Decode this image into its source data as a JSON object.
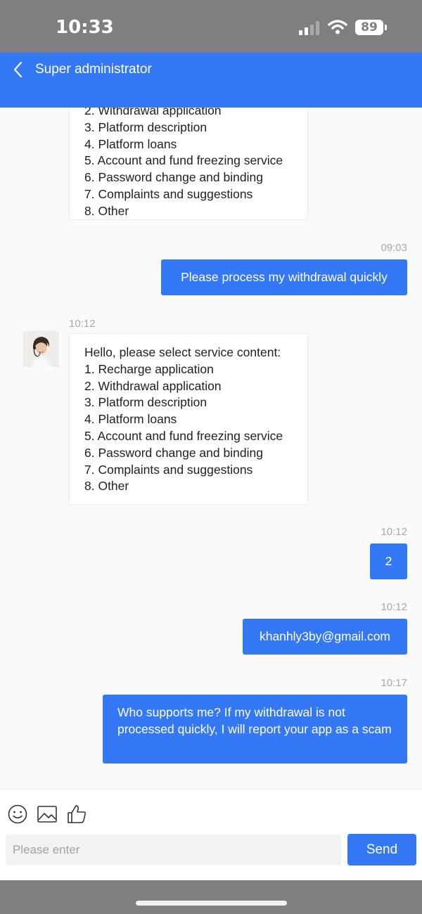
{
  "status": {
    "time": "10:33",
    "battery": "89"
  },
  "nav": {
    "title": "Super administrator"
  },
  "service_menu": {
    "greeting": "Hello, please select service content:",
    "items": [
      "1. Recharge application",
      "2. Withdrawal application",
      "3. Platform description",
      "4. Platform loans",
      "5. Account and fund freezing service",
      "6. Password change and binding",
      "7. Complaints and suggestions",
      "8. Other"
    ]
  },
  "messages": {
    "m1": {
      "time": "09:03",
      "text": "Please process my withdrawal quickly"
    },
    "m2": {
      "time": "10:12"
    },
    "m3": {
      "time": "10:12",
      "text": "2"
    },
    "m4": {
      "time": "10:12",
      "text": "khanhly3by@gmail.com"
    },
    "m5": {
      "time": "10:17",
      "text": "Who supports me? If my withdrawal is not processed quickly, I will report your app as a scam"
    }
  },
  "composer": {
    "placeholder": "Please enter",
    "send_label": "Send"
  },
  "icons": [
    "back-icon",
    "emoji-icon",
    "image-icon",
    "thumbs-up-icon",
    "signal-icon",
    "wifi-icon",
    "battery-icon"
  ],
  "colors": {
    "accent": "#3478f6",
    "status_bar": "#7f7f7f"
  }
}
